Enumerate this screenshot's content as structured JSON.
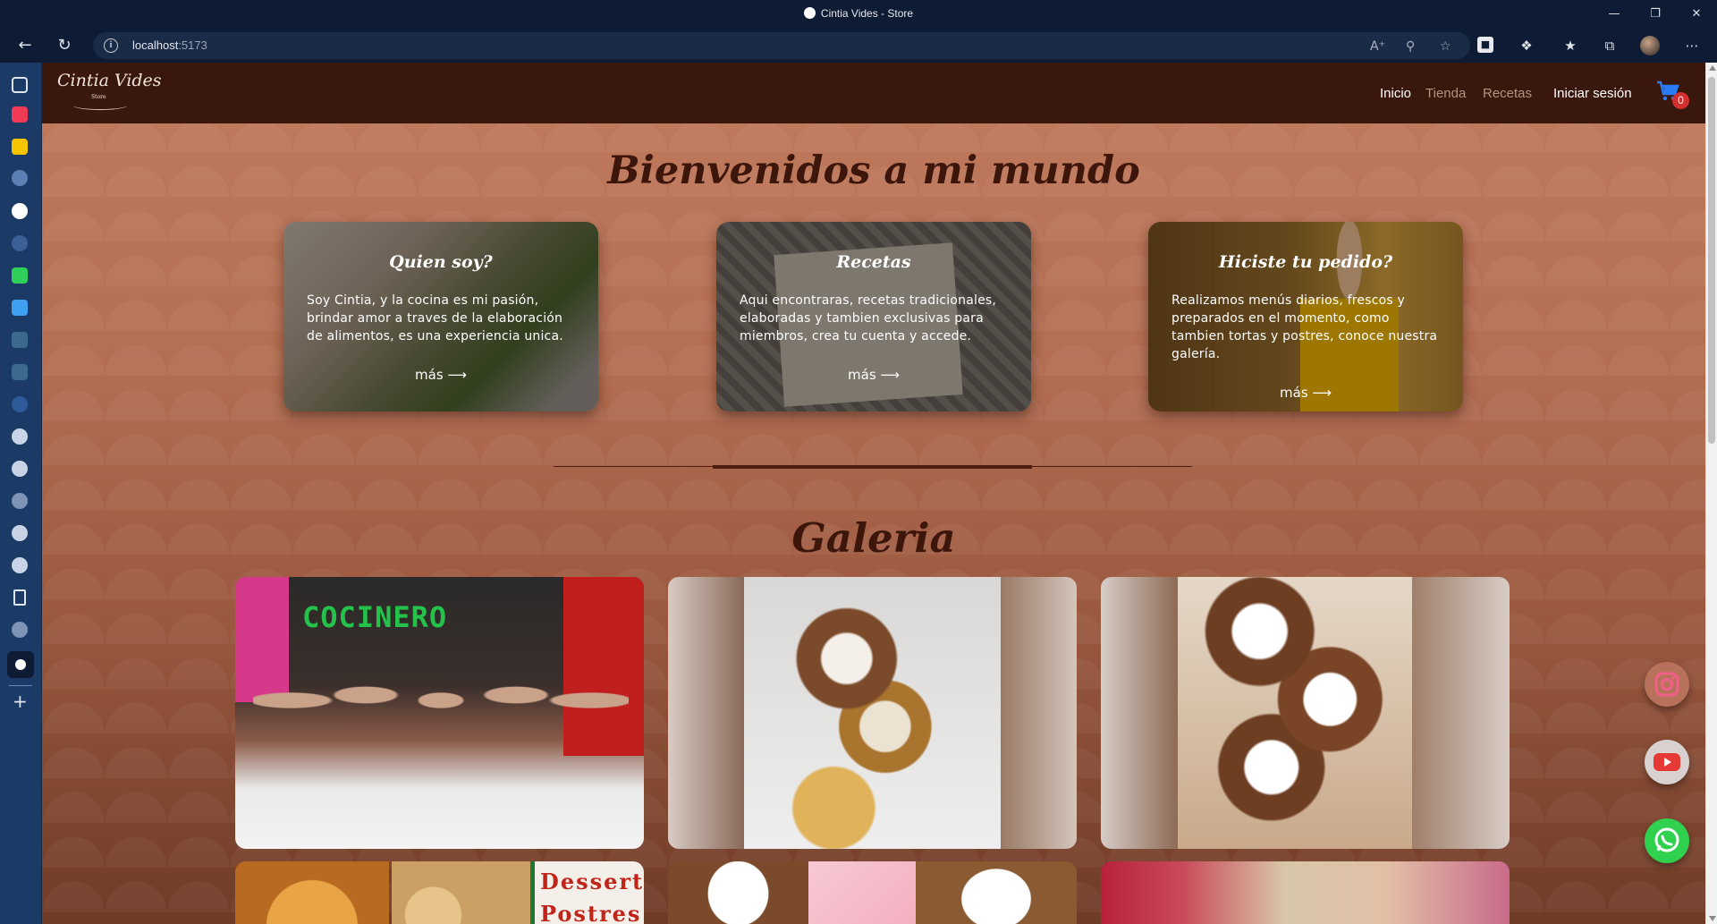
{
  "browser": {
    "window_title": "Cintia Vides - Store",
    "url_host": "localhost",
    "url_port": ":5173"
  },
  "site": {
    "logo_text": "Cintia Vides",
    "logo_sub": "Store",
    "nav": {
      "inicio": "Inicio",
      "tienda": "Tienda",
      "recetas": "Recetas",
      "login": "Iniciar sesión"
    },
    "cart_count": "0"
  },
  "main": {
    "welcome_title": "Bienvenidos a mi mundo",
    "gallery_title": "Galeria",
    "cards": [
      {
        "title": "Quien soy?",
        "text": "Soy Cintia, y la cocina es mi pasión, brindar amor a traves de la elaboración de alimentos, es una experiencia unica.",
        "more": "más ⟶"
      },
      {
        "title": "Recetas",
        "text": "Aqui encontraras, recetas tradicionales, elaboradas y tambien exclusivas para miembros, crea tu cuenta y accede.",
        "more": "más ⟶"
      },
      {
        "title": "Hiciste tu pedido?",
        "text": "Realizamos menús diarios, frescos y preparados en el momento, como tambien tortas y postres, conoce nuestra galería.",
        "more": "más ⟶"
      }
    ],
    "gallery": {
      "banner_text": "COCINERO",
      "dessert_line1": "Dessert",
      "dessert_line2": "Postres"
    }
  },
  "colors": {
    "nav_bg": "#3a170c",
    "heading": "#3d160b",
    "badge": "#d32f2f",
    "whatsapp": "#2fd14e",
    "youtube": "#e53935"
  }
}
